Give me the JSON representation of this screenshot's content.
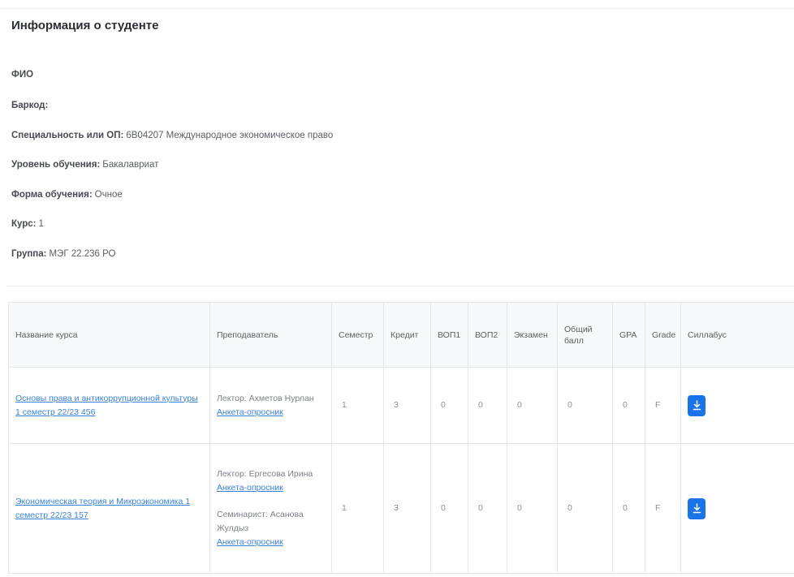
{
  "student_info": {
    "title": "Информация о студенте",
    "rows": [
      {
        "label": "ФИО",
        "value": ""
      },
      {
        "label": "Баркод:",
        "value": ""
      },
      {
        "label": "Специальность или ОП:",
        "value": "6В04207 Международное экономическое право"
      },
      {
        "label": "Уровень обучения:",
        "value": "Бакалавриат"
      },
      {
        "label": "Форма обучения:",
        "value": "Очное"
      },
      {
        "label": "Курс:",
        "value": "1"
      },
      {
        "label": "Группа:",
        "value": "МЭГ 22.236 РО"
      }
    ]
  },
  "table": {
    "headers": [
      "Название курса",
      "Преподаватель",
      "Семестр",
      "Кредит",
      "ВОП1",
      "ВОП2",
      "Экзамен",
      "Общий балл",
      "GPA",
      "Grade",
      "Силлабус"
    ],
    "rows": [
      {
        "course": "Основы права и антикоррупционной культуры 1 семестр 22/23 456",
        "teachers": [
          {
            "role_name": "Лектор: Ахметов Нурлан",
            "link": "Анкета-опросник"
          }
        ],
        "semester": "1",
        "credit": "3",
        "vop1": "0",
        "vop2": "0",
        "exam": "0",
        "total": "0",
        "gpa": "0",
        "grade": "F"
      },
      {
        "course": "Экономическая теория и Микроэкономика 1 семестр 22/23 157",
        "teachers": [
          {
            "role_name": "Лектор: Ергесова Ирина",
            "link": "Анкета-опросник"
          },
          {
            "role_name": "Семинарист: Асанова Жулдыз",
            "link": "Анкета-опросник"
          }
        ],
        "semester": "1",
        "credit": "3",
        "vop1": "0",
        "vop2": "0",
        "exam": "0",
        "total": "0",
        "gpa": "0",
        "grade": "F"
      }
    ],
    "syllabus_icon": "download-icon",
    "button_color": "#1a73e8"
  }
}
